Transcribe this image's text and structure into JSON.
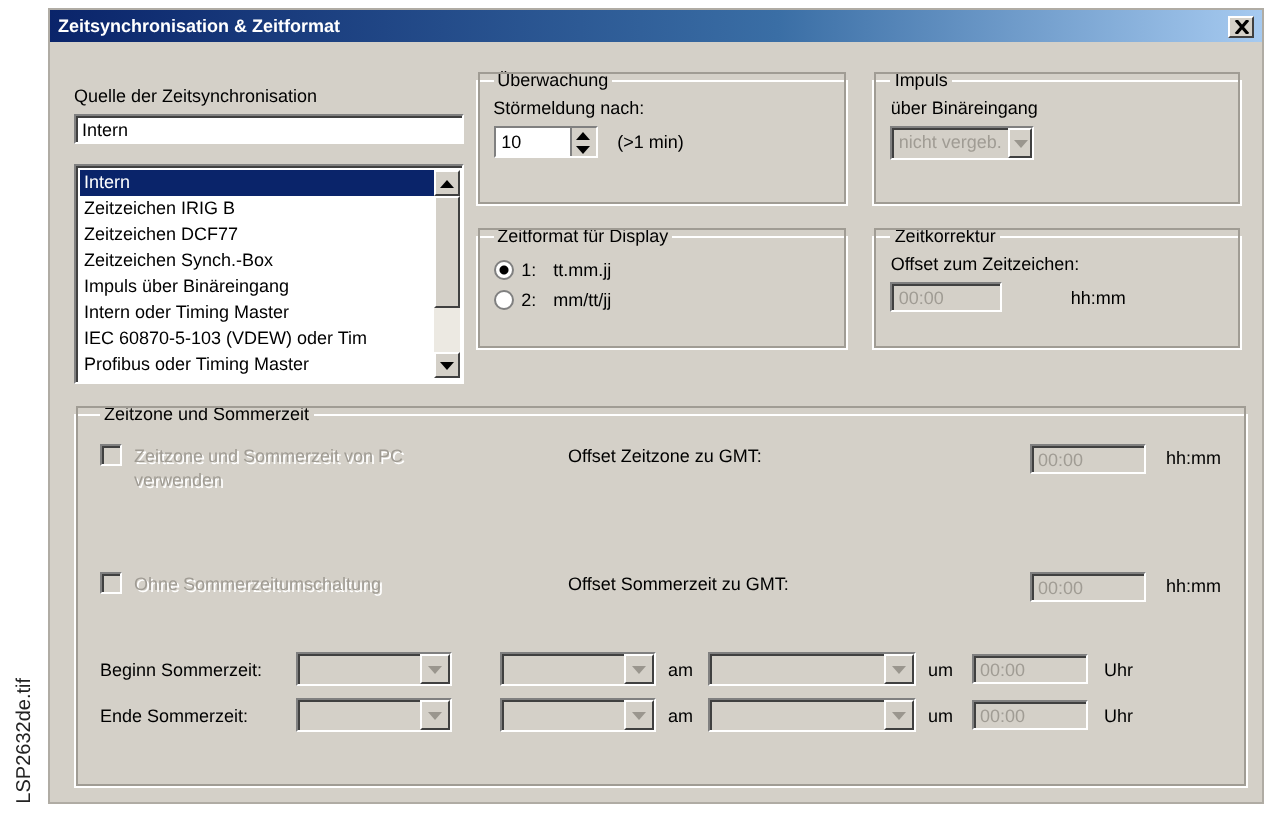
{
  "figure_label": "LSP2632de.tif",
  "window": {
    "title": "Zeitsynchronisation & Zeitformat"
  },
  "source": {
    "label": "Quelle der Zeitsynchronisation",
    "value": "Intern",
    "items": [
      {
        "label": "Intern",
        "selected": true
      },
      {
        "label": "Zeitzeichen IRIG B",
        "selected": false
      },
      {
        "label": "Zeitzeichen DCF77",
        "selected": false
      },
      {
        "label": "Zeitzeichen Synch.-Box",
        "selected": false
      },
      {
        "label": "Impuls über Binäreingang",
        "selected": false
      },
      {
        "label": "Intern oder Timing Master",
        "selected": false
      },
      {
        "label": "IEC 60870-5-103 (VDEW) oder Tim",
        "selected": false
      },
      {
        "label": "Profibus oder Timing Master",
        "selected": false
      }
    ]
  },
  "monitoring": {
    "title": "Überwachung",
    "label": "Störmeldung nach:",
    "value": "10",
    "unit": "(>1 min)"
  },
  "impulse": {
    "title": "Impuls",
    "label": "über Binäreingang",
    "value": "nicht vergeb.",
    "disabled": true
  },
  "display_format": {
    "title": "Zeitformat für Display",
    "options": [
      {
        "number": "1:",
        "label": "tt.mm.jj",
        "selected": true
      },
      {
        "number": "2:",
        "label": "mm/tt/jj",
        "selected": false
      }
    ]
  },
  "time_correction": {
    "title": "Zeitkorrektur",
    "label": "Offset zum Zeitzeichen:",
    "value": "00:00",
    "unit": "hh:mm",
    "disabled": true
  },
  "timezone": {
    "title": "Zeitzone und Sommerzeit",
    "offset_rows": [
      {
        "checkbox": "Zeitzone und Sommerzeit von PC verwenden",
        "checked": false,
        "disabled": true,
        "offset_label": "Offset Zeitzone zu GMT:",
        "value": "00:00",
        "unit": "hh:mm"
      },
      {
        "checkbox": "Ohne Sommerzeitumschaltung",
        "checked": false,
        "disabled": true,
        "offset_label": "Offset Sommerzeit zu GMT:",
        "value": "00:00",
        "unit": "hh:mm"
      }
    ],
    "dst_rows": [
      {
        "label": "Beginn Sommerzeit:",
        "word_1": "am",
        "word_2": "um",
        "value": "00:00",
        "unit": "Uhr",
        "disabled": true
      },
      {
        "label": "Ende Sommerzeit:",
        "word_1": "am",
        "word_2": "um",
        "value": "00:00",
        "unit": "Uhr",
        "disabled": true
      }
    ]
  }
}
